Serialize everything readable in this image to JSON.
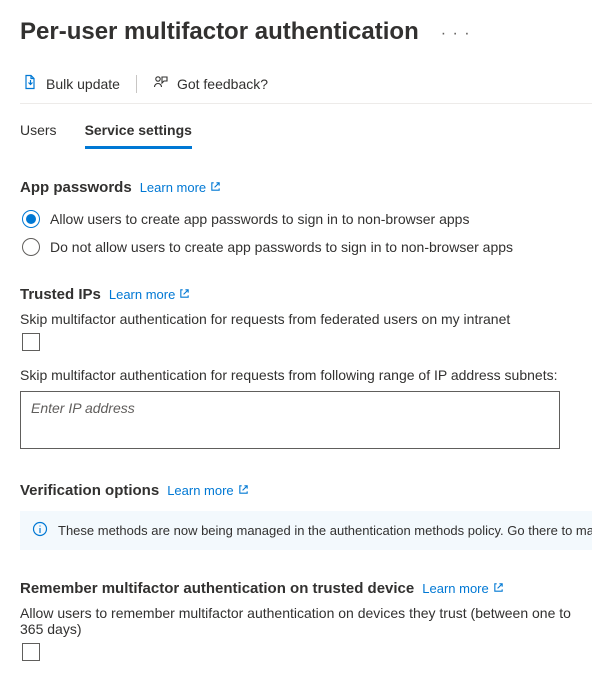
{
  "header": {
    "title": "Per-user multifactor authentication"
  },
  "toolbar": {
    "bulk_update": "Bulk update",
    "got_feedback": "Got feedback?"
  },
  "tabs": {
    "users": "Users",
    "service_settings": "Service settings"
  },
  "learn_more_label": "Learn more",
  "app_passwords": {
    "heading": "App passwords",
    "allow": "Allow users to create app passwords to sign in to non-browser apps",
    "deny": "Do not allow users to create app passwords to sign in to non-browser apps"
  },
  "trusted_ips": {
    "heading": "Trusted IPs",
    "skip_federated": "Skip multifactor authentication for requests from federated users on my intranet",
    "skip_range_label": "Skip multifactor authentication for requests from following range of IP address subnets:",
    "ip_placeholder": "Enter IP address"
  },
  "verification_options": {
    "heading": "Verification options",
    "banner": "These methods are now being managed in the authentication methods policy. Go there to manage methods."
  },
  "remember_mfa": {
    "heading": "Remember multifactor authentication on trusted device",
    "desc": "Allow users to remember multifactor authentication on devices they trust (between one to 365 days)"
  }
}
